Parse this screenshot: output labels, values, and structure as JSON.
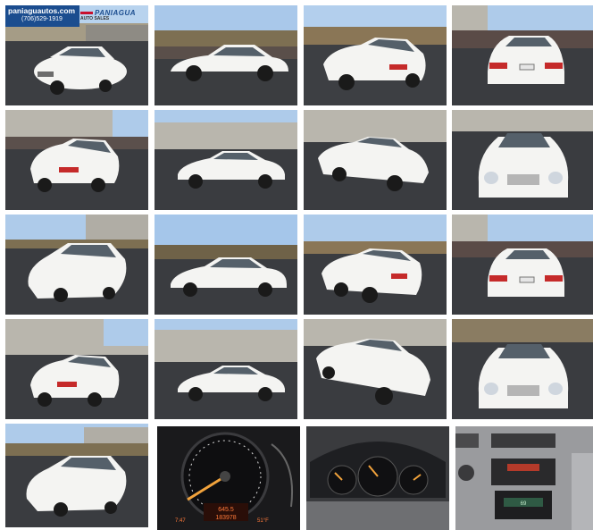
{
  "header": {
    "site": "paniaguautos.com",
    "phone": "(706)529-1919",
    "logo_text": "PANIAGUA",
    "logo_sub": "AUTO SALES"
  },
  "dashboard": {
    "odometer": "183978",
    "trip": "645.5",
    "time": "7:47",
    "outside": "51°F",
    "temp_display": "69"
  },
  "colors": {
    "sky": "#aac9ea",
    "asphalt": "#3a3c40",
    "car": "#f3f3f1",
    "building": "#b9b6ad",
    "trees": "#7a6a4a"
  }
}
